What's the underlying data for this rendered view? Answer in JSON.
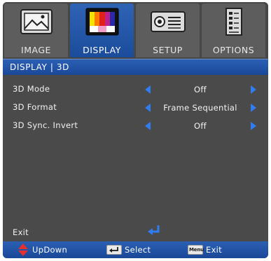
{
  "tabs": [
    {
      "label": "IMAGE",
      "icon": "image-icon",
      "active": false
    },
    {
      "label": "DISPLAY",
      "icon": "display-icon",
      "active": true
    },
    {
      "label": "SETUP",
      "icon": "projector-icon",
      "active": false
    },
    {
      "label": "OPTIONS",
      "icon": "options-icon",
      "active": false
    }
  ],
  "breadcrumb": "DISPLAY | 3D",
  "settings": [
    {
      "label": "3D Mode",
      "value": "Off"
    },
    {
      "label": "3D Format",
      "value": "Frame Sequential"
    },
    {
      "label": "3D Sync. Invert",
      "value": "Off"
    }
  ],
  "exit_label": "Exit",
  "footer": {
    "updown": "UpDown",
    "select": "Select",
    "menu_key": "Menu",
    "exit": "Exit"
  },
  "colors": {
    "accent_blue": "#2f7df0",
    "bar_blue": "#1f519f",
    "panel_gray": "#4a4a4a",
    "updown_red": "#e53030"
  }
}
